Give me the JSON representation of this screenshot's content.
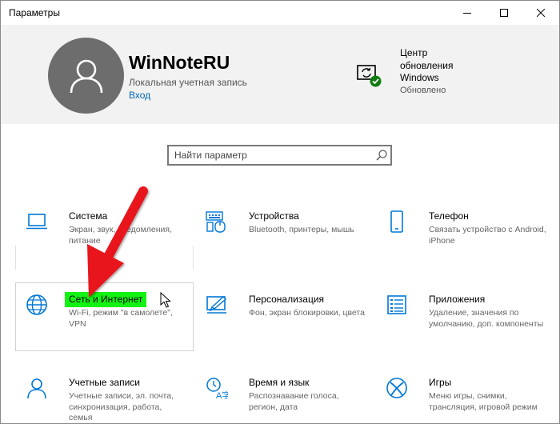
{
  "window": {
    "title": "Параметры",
    "controls": [
      "minimize",
      "maximize",
      "close"
    ]
  },
  "header": {
    "user_name": "WinNoteRU",
    "account_type": "Локальная учетная запись",
    "signin_link": "Вход",
    "update": {
      "title": "Центр обновления Windows",
      "status": "Обновлено",
      "icon": "windows-update-icon",
      "status_color": "#107c10"
    }
  },
  "search": {
    "placeholder": "Найти параметр",
    "icon": "search-icon"
  },
  "tiles": [
    {
      "title": "Система",
      "desc": "Экран, звук, уведомления, питание",
      "icon": "laptop-icon"
    },
    {
      "title": "Устройства",
      "desc": "Bluetooth, принтеры, мышь",
      "icon": "devices-icon"
    },
    {
      "title": "Телефон",
      "desc": "Связать устройство с Android, iPhone",
      "icon": "phone-icon"
    },
    {
      "title": "Сеть и Интернет",
      "desc": "Wi-Fi, режим \"в самолете\", VPN",
      "icon": "globe-icon",
      "highlighted": true
    },
    {
      "title": "Персонализация",
      "desc": "Фон, экран блокировки, цвета",
      "icon": "personalization-icon"
    },
    {
      "title": "Приложения",
      "desc": "Удаление, значения по умолчанию, доп. компоненты",
      "icon": "apps-icon"
    },
    {
      "title": "Учетные записи",
      "desc": "Учетные записи, эл. почта, синхронизация, работа, семья",
      "icon": "person-icon"
    },
    {
      "title": "Время и язык",
      "desc": "Распознавание голоса, регион, дата",
      "icon": "time-language-icon"
    },
    {
      "title": "Игры",
      "desc": "Меню игры, снимки, трансляция, игровой режим",
      "icon": "xbox-icon"
    }
  ],
  "colors": {
    "accent": "#0078d7",
    "link": "#0066b4",
    "highlight": "#13f313",
    "annotation_arrow": "#e8141e",
    "header_bg": "#f2f2f2"
  }
}
